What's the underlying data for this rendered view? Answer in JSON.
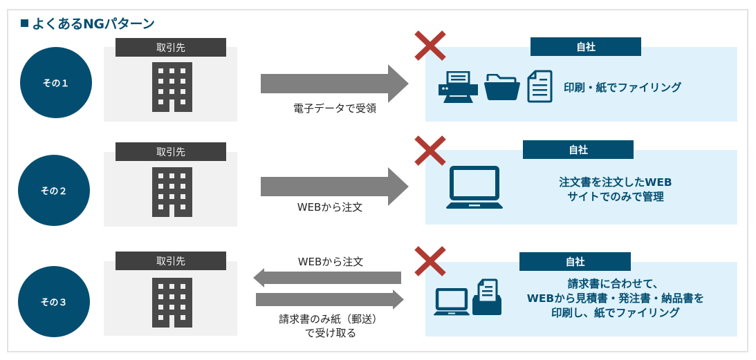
{
  "title": "よくあるNGパターン",
  "colors": {
    "primary": "#034e70",
    "partner_label_bg": "#404040",
    "partner_box_bg": "#f1f1f1",
    "own_box_bg": "#dff2fc",
    "arrow": "#808080",
    "x_mark": "#b03a32"
  },
  "patterns": [
    {
      "badge": "その１",
      "partner": {
        "label": "取引先",
        "icon": "office-building-icon"
      },
      "arrows": [
        {
          "direction": "right",
          "label": "電子データで受領"
        }
      ],
      "status_icon": "x-mark-icon",
      "own": {
        "label": "自社",
        "icons": [
          "printer-icon",
          "folder-icon",
          "document-icon"
        ],
        "text_lines": [
          "印刷・紙でファイリング"
        ]
      }
    },
    {
      "badge": "その２",
      "partner": {
        "label": "取引先",
        "icon": "office-building-icon"
      },
      "arrows": [
        {
          "direction": "right",
          "label": "WEBから注文"
        }
      ],
      "status_icon": "x-mark-icon",
      "own": {
        "label": "自社",
        "icons": [
          "laptop-icon"
        ],
        "text_lines": [
          "注文書を注文したWEB",
          "サイトでのみで管理"
        ]
      }
    },
    {
      "badge": "その３",
      "partner": {
        "label": "取引先",
        "icon": "office-building-icon"
      },
      "arrows": [
        {
          "direction": "left",
          "label": "WEBから注文"
        },
        {
          "direction": "right",
          "label_lines": [
            "請求書のみ紙（郵送）",
            "で受け取る"
          ]
        }
      ],
      "status_icon": "x-mark-icon",
      "own": {
        "label": "自社",
        "icons": [
          "laptop-icon",
          "document-tray-icon"
        ],
        "text_lines": [
          "請求書に合わせて、",
          "WEBから見積書・発注書・納品書を",
          "印刷し、紙でファイリング"
        ]
      }
    }
  ]
}
